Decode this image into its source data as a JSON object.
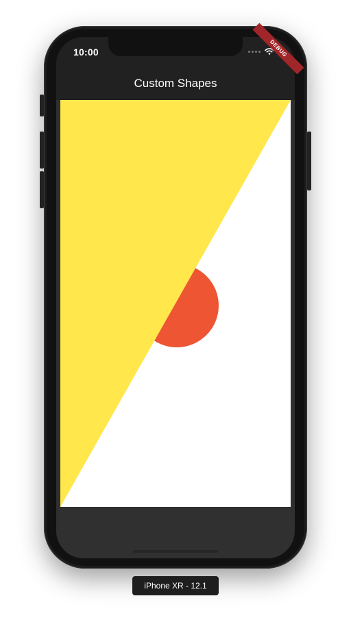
{
  "status_bar": {
    "time": "10:00",
    "icons": [
      "signal-dots-icon",
      "wifi-icon"
    ]
  },
  "debug_banner": {
    "label": "DEBUG"
  },
  "app_bar": {
    "title": "Custom Shapes"
  },
  "shapes": {
    "triangle_color": "#ffe74c",
    "circle_color": "#ee5533",
    "background_color": "#ffffff"
  },
  "device": {
    "label": "iPhone XR - 12.1"
  },
  "colors": {
    "app_bar": "#212121",
    "screen_bottom": "#303030",
    "phone_body": "#1c1c1c",
    "debug_banner": "#a0262a"
  }
}
